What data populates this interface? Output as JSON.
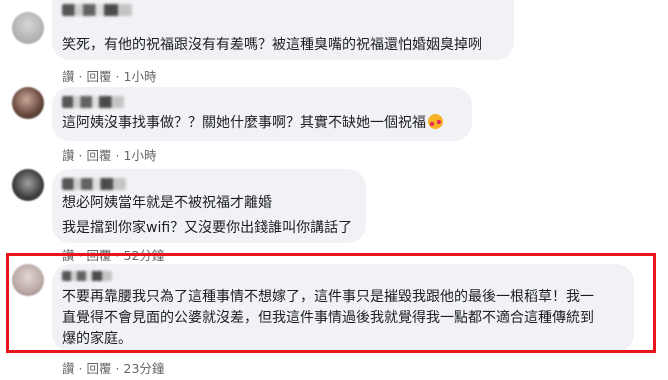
{
  "meta_labels": {
    "like": "讚",
    "reply": "回覆",
    "separator": "·"
  },
  "comments": [
    {
      "lines": [
        "笑死，有他的祝福跟沒有有差嗎？被這種臭嘴的祝福還怕婚姻臭掉咧"
      ],
      "time": "1小時"
    },
    {
      "lines": [
        "這阿姨沒事找事做？？關她什麼事啊？其實不缺她一個祝福"
      ],
      "emoji": "smiling-face-with-hearts",
      "time": "1小時"
    },
    {
      "lines": [
        "想必阿姨當年就是不被祝福才離婚",
        "我是擋到你家wifi？又沒要你出錢誰叫你講話了"
      ],
      "time": "52分鐘"
    },
    {
      "lines": [
        "不要再靠腰我只為了這種事情不想嫁了，這件事只是摧毀我跟他的最後一根稻草！我一",
        "直覺得不會見面的公婆就沒差，但我這件事情過後我就覺得我一點都不適合這種傳統到",
        "爆的家庭。"
      ],
      "time": "23分鐘",
      "highlighted": true
    }
  ],
  "colors": {
    "bubble": "#f0f2f5",
    "meta": "#65676b",
    "highlight_border": "#e8161c"
  }
}
